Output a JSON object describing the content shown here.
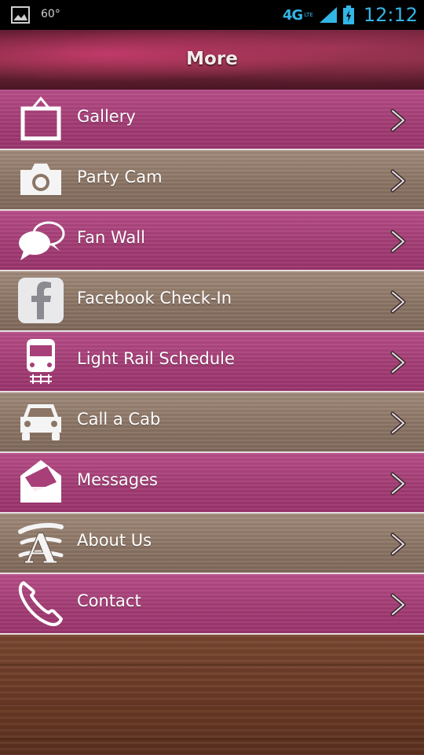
{
  "status_bar": {
    "temperature": "60°",
    "network": "4G",
    "network_sub": "LTE",
    "time": "12:12"
  },
  "header": {
    "title": "More"
  },
  "menu": {
    "items": [
      {
        "label": "Gallery",
        "icon": "picture-frame-icon",
        "color": "pink"
      },
      {
        "label": "Party Cam",
        "icon": "camera-icon",
        "color": "tan"
      },
      {
        "label": "Fan Wall",
        "icon": "chat-bubbles-icon",
        "color": "pink"
      },
      {
        "label": "Facebook Check-In",
        "icon": "facebook-icon",
        "color": "tan"
      },
      {
        "label": "Light Rail Schedule",
        "icon": "train-icon",
        "color": "pink"
      },
      {
        "label": "Call a Cab",
        "icon": "car-icon",
        "color": "tan"
      },
      {
        "label": "Messages",
        "icon": "envelope-icon",
        "color": "pink"
      },
      {
        "label": "About Us",
        "icon": "letter-a-icon",
        "color": "tan"
      },
      {
        "label": "Contact",
        "icon": "phone-icon",
        "color": "pink"
      }
    ]
  },
  "colors": {
    "pink": "#a83f79",
    "tan": "#8c7565",
    "accent": "#33b5e5"
  }
}
